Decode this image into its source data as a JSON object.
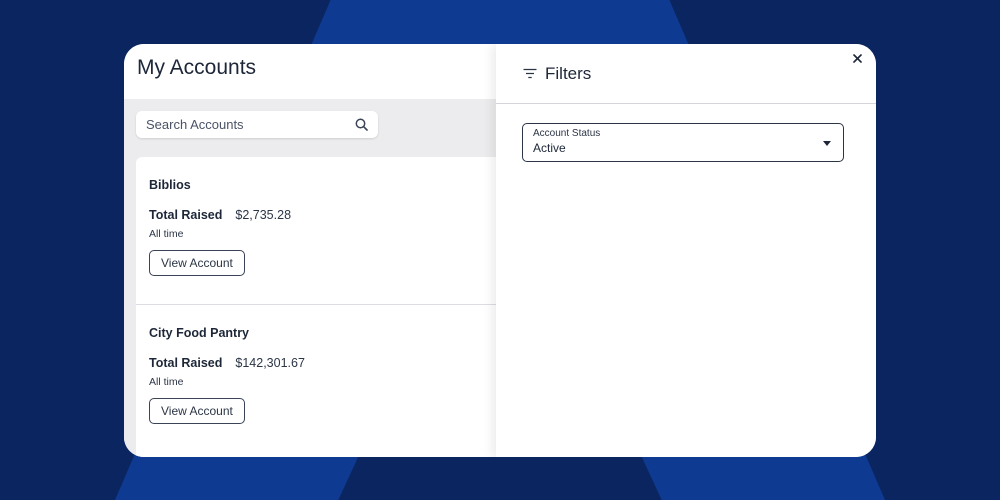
{
  "page": {
    "title": "My Accounts"
  },
  "search": {
    "placeholder": "Search Accounts",
    "icon": "search-icon"
  },
  "accounts": [
    {
      "name": "Biblios",
      "total_label": "Total Raised",
      "total_value": "$2,735.28",
      "period": "All time",
      "button_label": "View Account"
    },
    {
      "name": "City Food Pantry",
      "total_label": "Total Raised",
      "total_value": "$142,301.67",
      "period": "All time",
      "button_label": "View Account"
    }
  ],
  "filters": {
    "title": "Filters",
    "icon": "filter-icon",
    "close_icon": "close-icon",
    "account_status": {
      "label": "Account Status",
      "value": "Active",
      "icon": "caret-down-icon"
    }
  },
  "colors": {
    "background": "#0b2560",
    "accent_shape": "#0e3a91",
    "panel_gray": "#ececee"
  }
}
